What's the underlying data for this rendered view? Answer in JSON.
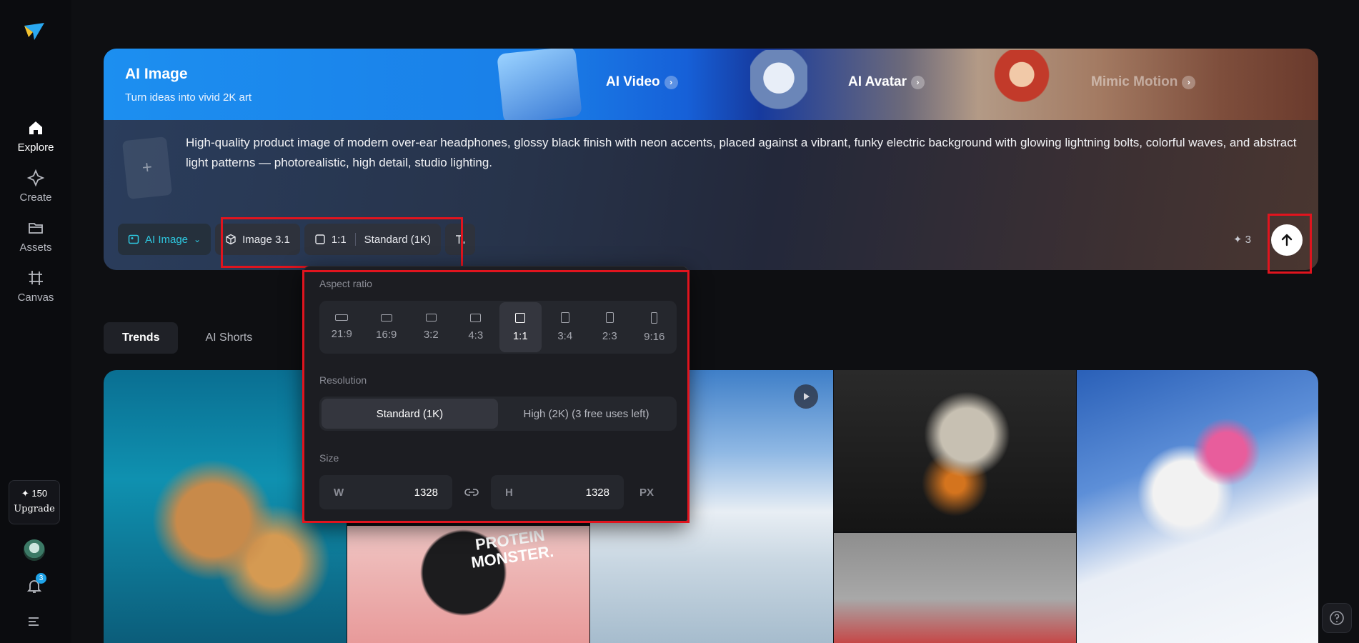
{
  "sidebar": {
    "items": [
      {
        "label": "Explore",
        "icon": "home-icon",
        "active": true
      },
      {
        "label": "Create",
        "icon": "sparkle-icon"
      },
      {
        "label": "Assets",
        "icon": "folder-icon"
      },
      {
        "label": "Canvas",
        "icon": "crop-icon"
      }
    ],
    "credits": "✦ 150",
    "upgrade_label": "Upgrade",
    "notification_count": "3"
  },
  "hero": {
    "title": "AI Image",
    "subtitle": "Turn ideas into vivid 2K art",
    "promos": [
      {
        "label": "AI Video"
      },
      {
        "label": "AI Avatar"
      },
      {
        "label": "Mimic Motion"
      }
    ],
    "upload_symbol": "+",
    "prompt": "High-quality product image of modern over-ear headphones, glossy black finish with neon accents, placed against a vibrant, funky electric background with glowing lightning bolts, colorful waves, and abstract light patterns — photorealistic, high detail, studio lighting.",
    "toolbar": {
      "mode_label": "AI Image",
      "model_label": "Image 3.1",
      "ratio_label": "1:1",
      "resolution_label": "Standard (1K)"
    },
    "credit_cost": "✦ 3"
  },
  "tabs": [
    "Trends",
    "AI Shorts"
  ],
  "gallery": {
    "protein_text": "PROTEIN MONSTER."
  },
  "dropdown": {
    "aspect_label": "Aspect ratio",
    "ratios": [
      "21:9",
      "16:9",
      "3:2",
      "4:3",
      "1:1",
      "3:4",
      "2:3",
      "9:16"
    ],
    "selected_ratio": "1:1",
    "resolution_label": "Resolution",
    "resolutions": [
      "Standard (1K)",
      "High (2K)  (3 free uses left)"
    ],
    "size_label": "Size",
    "width_key": "W",
    "width_value": "1328",
    "height_key": "H",
    "height_value": "1328",
    "unit": "PX"
  },
  "colors": {
    "accent_cyan": "#2ec8e0",
    "highlight_red": "#e0141e",
    "badge_blue": "#1fa3e8"
  }
}
